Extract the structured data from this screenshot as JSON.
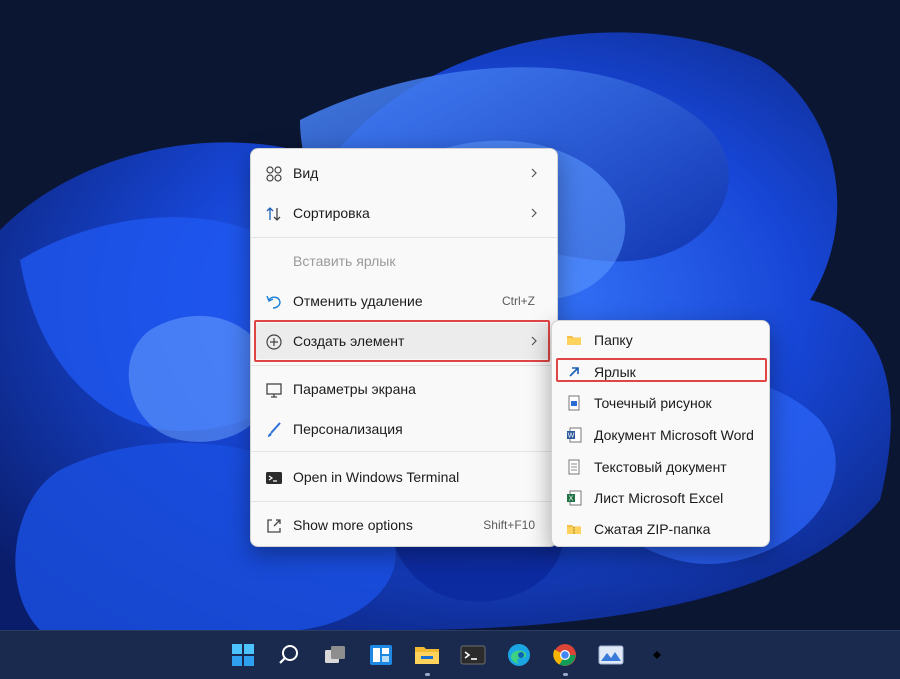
{
  "context_menu": {
    "items": [
      {
        "label": "Вид",
        "icon": "view-grid-icon"
      },
      {
        "label": "Сортировка",
        "icon": "sort-icon"
      },
      {
        "label": "Вставить ярлык",
        "icon": "none"
      },
      {
        "label": "Отменить удаление",
        "shortcut": "Ctrl+Z",
        "icon": "undo-icon"
      },
      {
        "label": "Создать элемент",
        "icon": "new-plus-icon"
      },
      {
        "label": "Параметры экрана",
        "icon": "display-icon"
      },
      {
        "label": "Персонализация",
        "icon": "brush-icon"
      },
      {
        "label": "Open in Windows Terminal",
        "icon": "terminal-icon"
      },
      {
        "label": "Show more options",
        "shortcut": "Shift+F10",
        "icon": "share-icon"
      }
    ]
  },
  "submenu": {
    "items": [
      {
        "label": "Папку",
        "icon": "folder-icon"
      },
      {
        "label": "Ярлык",
        "icon": "shortcut-arrow-icon"
      },
      {
        "label": "Точечный рисунок",
        "icon": "bitmap-icon"
      },
      {
        "label": "Документ Microsoft Word",
        "icon": "word-icon"
      },
      {
        "label": "Текстовый документ",
        "icon": "text-document-icon"
      },
      {
        "label": "Лист Microsoft Excel",
        "icon": "excel-icon"
      },
      {
        "label": "Сжатая ZIP-папка",
        "icon": "zip-folder-icon"
      }
    ]
  },
  "taskbar": {
    "icons": [
      "start-icon",
      "search-icon",
      "task-view-icon",
      "widgets-icon",
      "file-explorer-icon",
      "terminal-icon",
      "edge-icon",
      "chrome-icon",
      "photos-icon",
      "more-icon"
    ]
  },
  "colors": {
    "highlight": "#e04545",
    "menu_bg": "#f9f9f9",
    "accent": "#0067c0"
  }
}
